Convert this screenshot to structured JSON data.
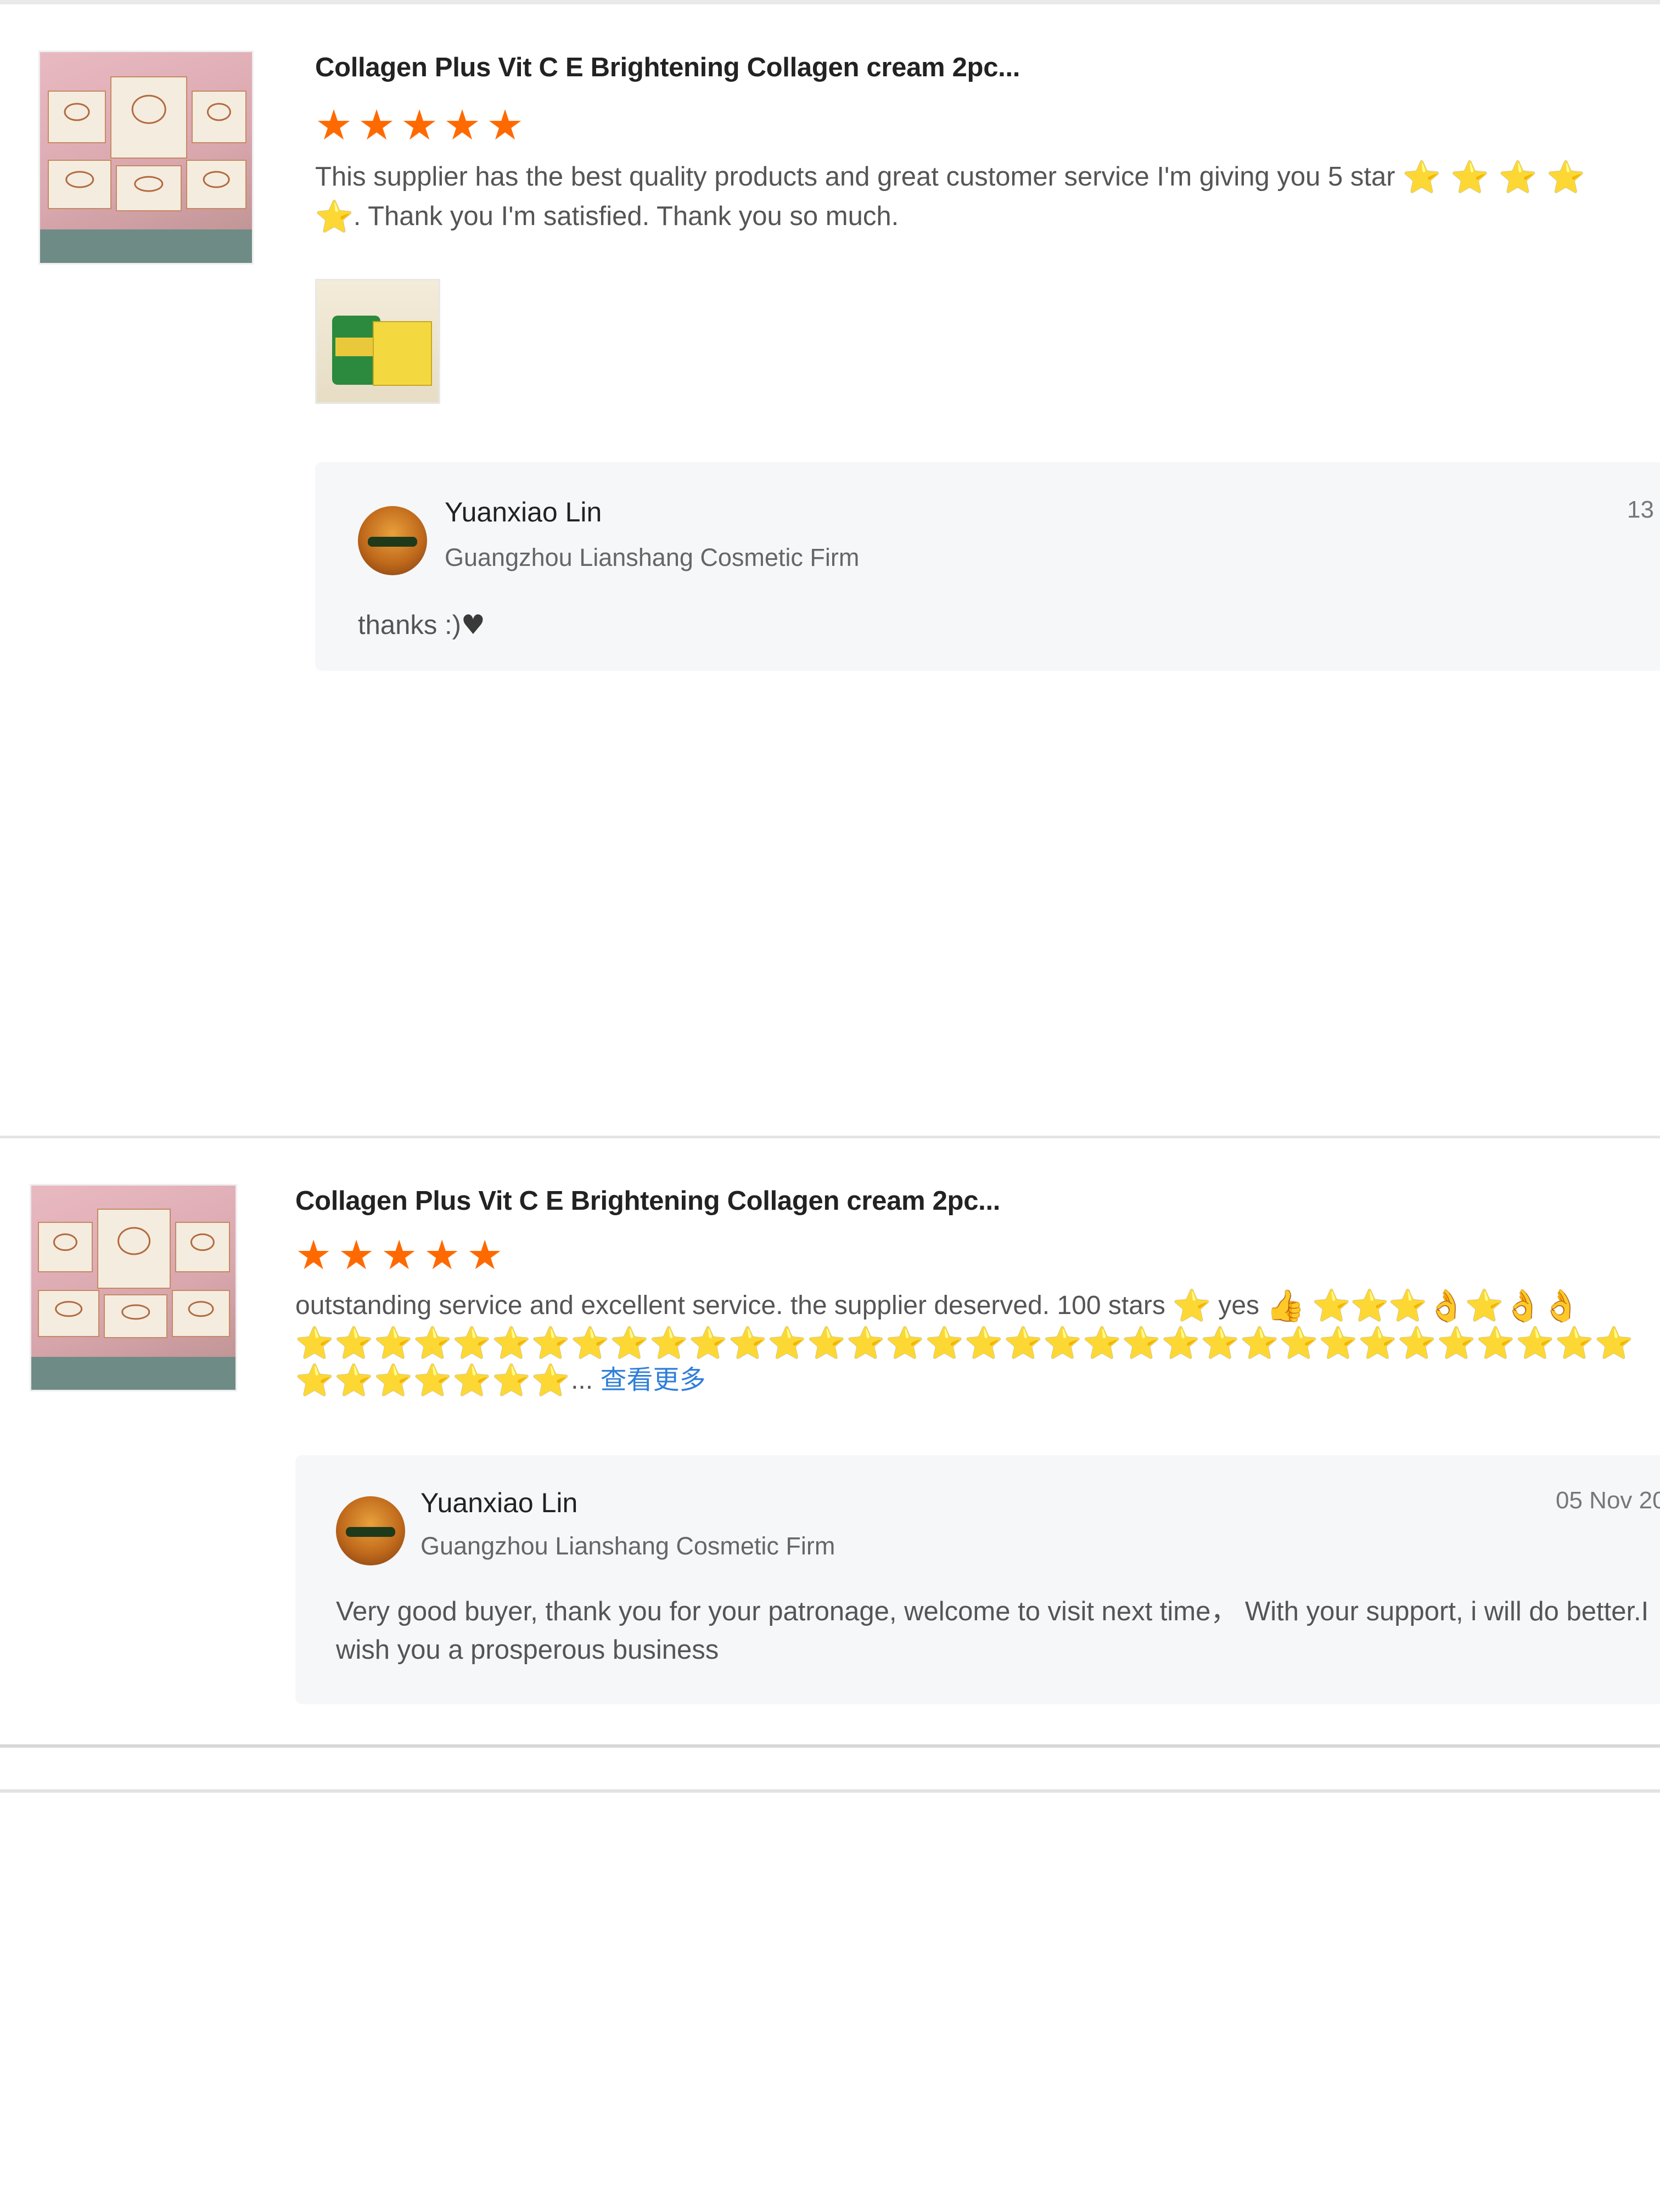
{
  "reviews": [
    {
      "product_title": "Collagen Plus Vit C E Brightening Collagen cream 2pc...",
      "rating": 5,
      "rating_max": 5,
      "text": "This supplier has the best quality products and great customer service I'm giving you 5 star",
      "text_emojis": "⭐ ⭐ ⭐ ⭐",
      "text_line2_emoji": "⭐",
      "text_continued": ". Thank you I'm satisfied. Thank you so much.",
      "reply": {
        "seller_name": "Yuanxiao Lin",
        "shop_name": "Guangzhou Lianshang Cosmetic Firm",
        "date": "13",
        "text": "thanks :)",
        "text_icon": "♥"
      }
    },
    {
      "product_title": "Collagen Plus Vit C E Brightening Collagen cream 2pc...",
      "rating": 5,
      "rating_max": 5,
      "text": "outstanding service and excellent service. the supplier deserved. 100 stars",
      "text_segment_yes": "yes",
      "emoji_line1_a": "⭐",
      "emoji_line1_b": "👍",
      "emoji_line1_c": "⭐⭐⭐👌⭐👌👌",
      "emoji_line2": "⭐⭐⭐⭐⭐⭐⭐⭐⭐⭐⭐⭐⭐⭐⭐⭐⭐⭐⭐⭐⭐⭐⭐⭐⭐⭐⭐⭐⭐⭐⭐⭐⭐⭐",
      "emoji_line3": "⭐⭐⭐⭐⭐⭐⭐",
      "ellipsis": "...",
      "see_more": "查看更多",
      "reply": {
        "seller_name": "Yuanxiao Lin",
        "shop_name": "Guangzhou Lianshang Cosmetic Firm",
        "date": "05 Nov 20",
        "text": "Very good buyer, thank you for your patronage, welcome to visit next time， With your support, i will do better.I wish you a prosperous business"
      }
    }
  ],
  "icons": {
    "rating_star": "star-icon",
    "avatar": "seller-avatar"
  },
  "colors": {
    "rating_star": "#ff6a00",
    "see_more_link": "#2f7fd9",
    "reply_background": "#f6f7f9"
  }
}
